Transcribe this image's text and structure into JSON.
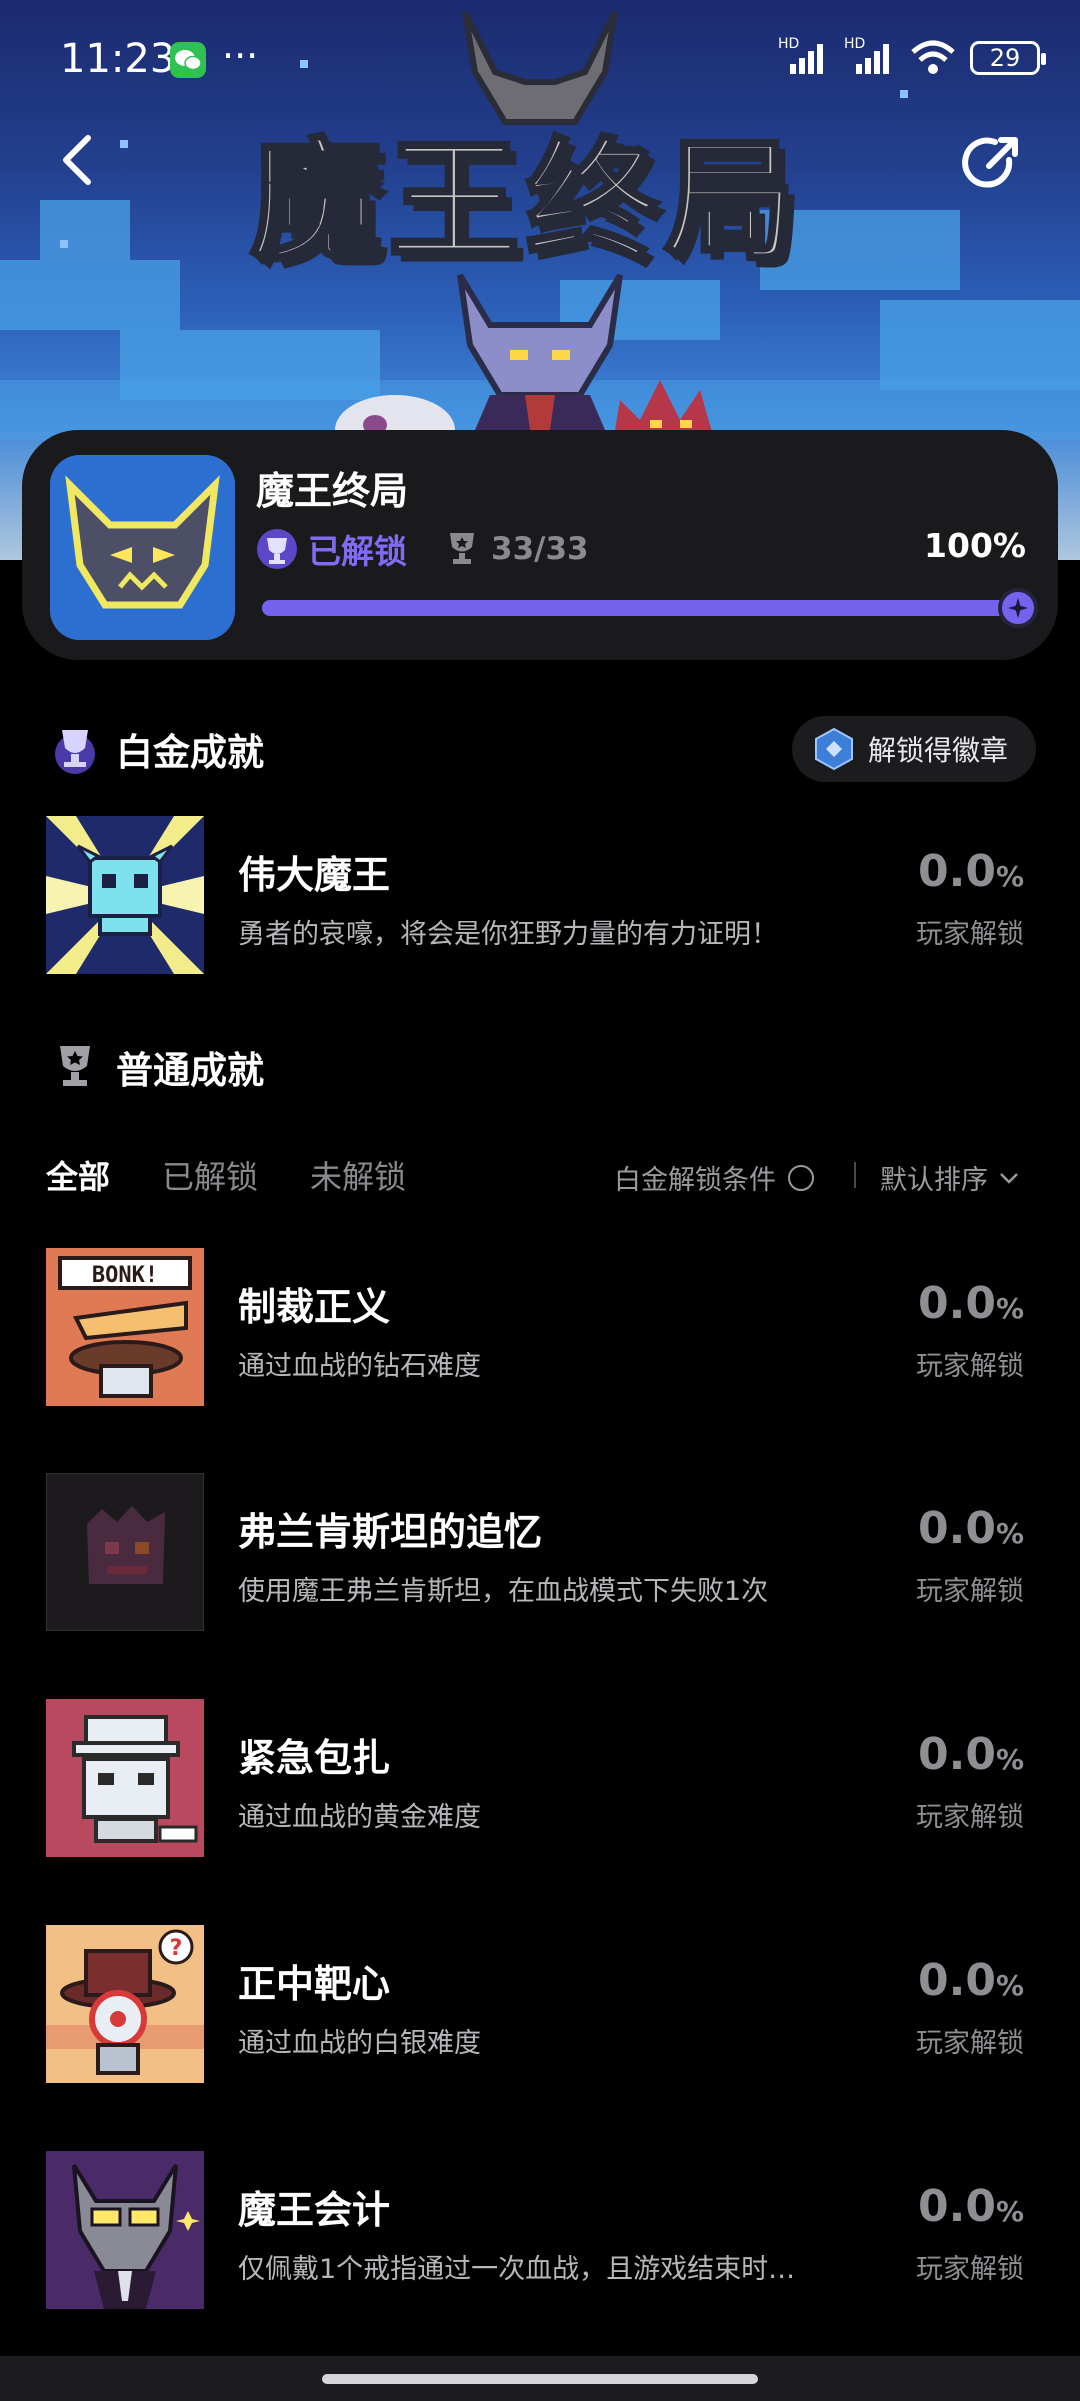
{
  "status_bar": {
    "time": "11:23",
    "extra": "···",
    "battery": "29",
    "signal_label": "HD"
  },
  "header": {
    "banner_title": "魔王终局"
  },
  "game": {
    "name": "魔王终局",
    "unlock_status": "已解锁",
    "count": "33/33",
    "percent": "100%",
    "progress": 1.0,
    "accent_color": "#7563ee"
  },
  "platinum": {
    "title": "白金成就",
    "badge_button": "解锁得徽章",
    "items": [
      {
        "name": "伟大魔王",
        "desc": "勇者的哀嚎，将会是你狂野力量的有力证明！",
        "pct": "0.0",
        "pct_unit": "%",
        "sub": "玩家解锁"
      }
    ]
  },
  "normal": {
    "title": "普通成就",
    "tabs": [
      "全部",
      "已解锁",
      "未解锁"
    ],
    "condition_label": "白金解锁条件",
    "sort_label": "默认排序",
    "items": [
      {
        "name": "制裁正义",
        "desc": "通过血战的钻石难度",
        "pct": "0.0",
        "pct_unit": "%",
        "sub": "玩家解锁",
        "thumb_text": "BONK!"
      },
      {
        "name": "弗兰肯斯坦的追忆",
        "desc": "使用魔王弗兰肯斯坦，在血战模式下失败1次",
        "pct": "0.0",
        "pct_unit": "%",
        "sub": "玩家解锁"
      },
      {
        "name": "紧急包扎",
        "desc": "通过血战的黄金难度",
        "pct": "0.0",
        "pct_unit": "%",
        "sub": "玩家解锁"
      },
      {
        "name": "正中靶心",
        "desc": "通过血战的白银难度",
        "pct": "0.0",
        "pct_unit": "%",
        "sub": "玩家解锁"
      },
      {
        "name": "魔王会计",
        "desc": "仅佩戴1个戒指通过一次血战，且游戏结束时…",
        "pct": "0.0",
        "pct_unit": "%",
        "sub": "玩家解锁"
      }
    ]
  }
}
